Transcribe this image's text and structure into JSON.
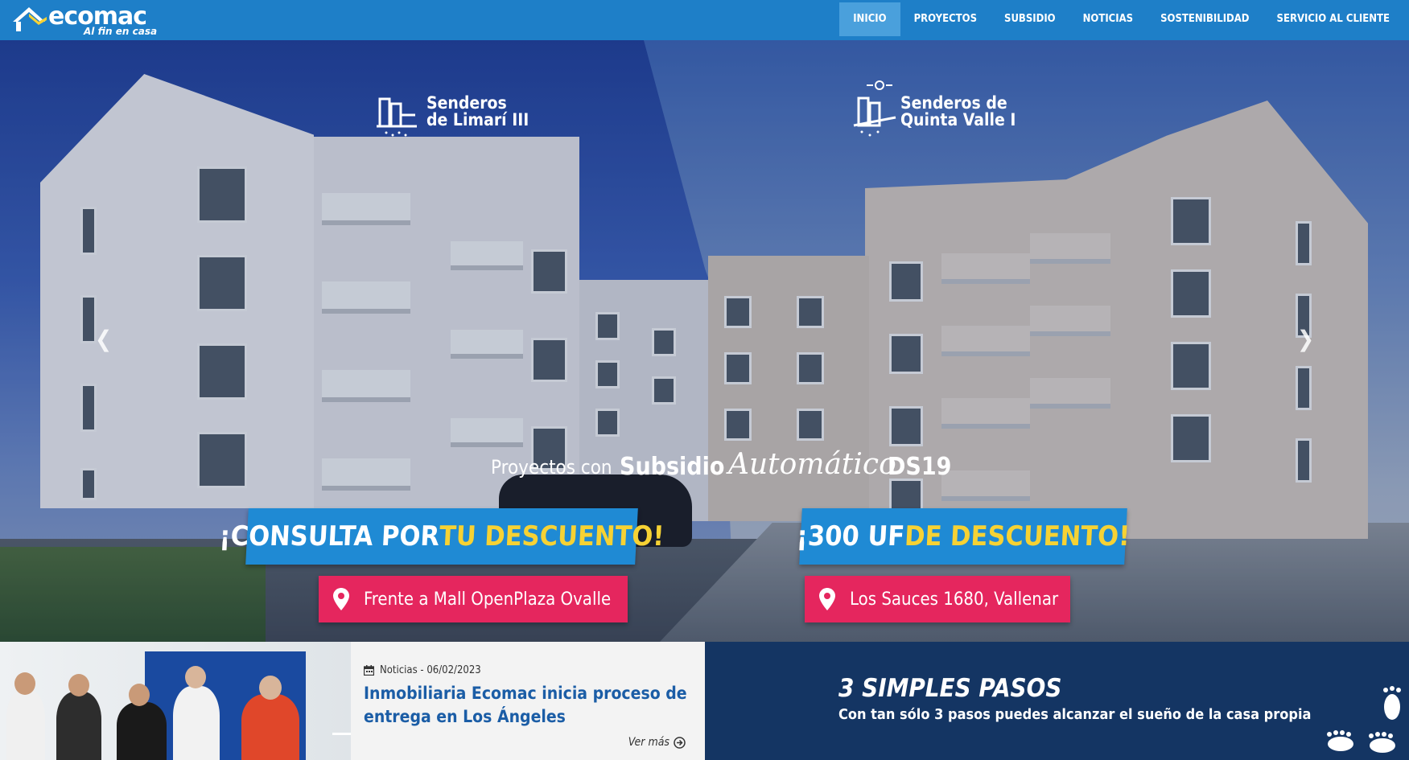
{
  "brand": {
    "name": "ecomac",
    "tagline": "Al fin en casa"
  },
  "nav": {
    "items": [
      {
        "label": "INICIO",
        "active": true
      },
      {
        "label": "PROYECTOS",
        "active": false
      },
      {
        "label": "SUBSIDIO",
        "active": false
      },
      {
        "label": "NOTICIAS",
        "active": false
      },
      {
        "label": "SOSTENIBILIDAD",
        "active": false
      },
      {
        "label": "SERVICIO AL CLIENTE",
        "active": false
      }
    ]
  },
  "hero": {
    "left_project": {
      "line1": "Senderos",
      "line2": "de Limarí III"
    },
    "right_project": {
      "line1": "Senderos de",
      "line2": "Quinta Valle I"
    },
    "subsidio": {
      "prefix": "Proyectos con",
      "word": "Subsidio",
      "script": "Automático",
      "code": "DS19"
    },
    "left_banner": {
      "white": "¡CONSULTA POR ",
      "yellow": "TU DESCUENTO!"
    },
    "right_banner": {
      "white": "¡300 UF ",
      "yellow": "DE DESCUENTO!"
    },
    "left_location": "Frente a Mall OpenPlaza Ovalle",
    "right_location": "Los Sauces 1680, Vallenar",
    "prev_icon": "chevron-left-icon",
    "next_icon": "chevron-right-icon"
  },
  "news": {
    "category_date": "Noticias - 06/02/2023",
    "title": "Inmobiliaria Ecomac inicia proceso de entrega en Los Ángeles",
    "more": "Ver más"
  },
  "steps": {
    "title": "3 SIMPLES PASOS",
    "subtitle": "Con tan sólo 3 pasos puedes alcanzar el sueño de la casa propia"
  },
  "colors": {
    "header": "#1e7fc8",
    "nav_active": "#4aa0dc",
    "banner_blue": "#1f8ad4",
    "banner_yellow": "#f6d234",
    "location_pink": "#e5265e",
    "news_title": "#1b5da6",
    "steps_bg": "#143563"
  }
}
